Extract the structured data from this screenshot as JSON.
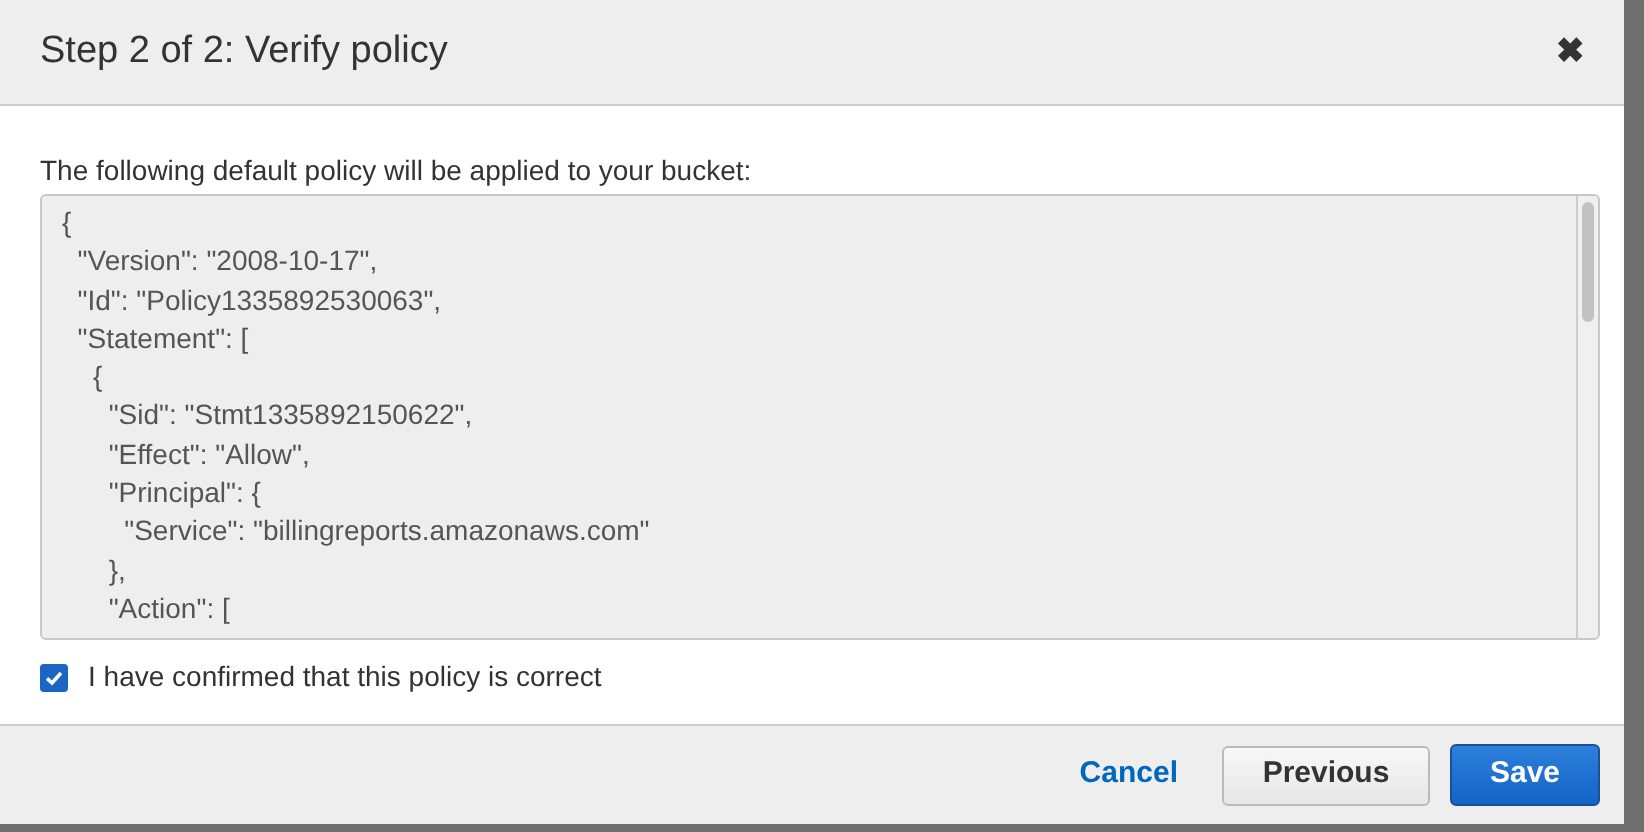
{
  "dialog": {
    "title": "Step 2 of 2: Verify policy",
    "close_icon": "✖",
    "intro": "The following default policy will be applied to your bucket:",
    "policy_lines": [
      "{",
      "  \"Version\": \"2008-10-17\",",
      "  \"Id\": \"Policy1335892530063\",",
      "  \"Statement\": [",
      "    {",
      "      \"Sid\": \"Stmt1335892150622\",",
      "      \"Effect\": \"Allow\",",
      "      \"Principal\": {",
      "        \"Service\": \"billingreports.amazonaws.com\"",
      "      },",
      "      \"Action\": ["
    ],
    "confirm": {
      "label": "I have confirmed that this policy is correct",
      "checked": true
    },
    "buttons": [
      {
        "label": "Cancel",
        "kind": "link"
      },
      {
        "label": "Previous",
        "kind": "secondary"
      },
      {
        "label": "Save",
        "kind": "primary"
      }
    ]
  }
}
